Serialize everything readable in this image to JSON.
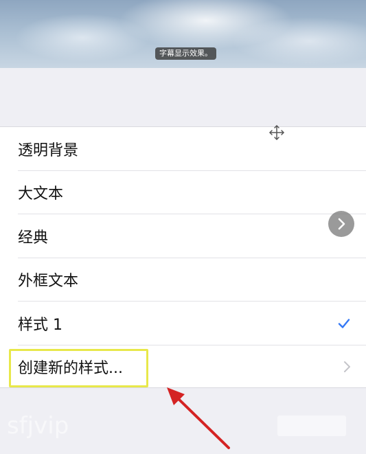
{
  "preview": {
    "subtitle_sample": "字幕显示效果。"
  },
  "styles_list": {
    "items": [
      {
        "label": "透明背景",
        "selected": false
      },
      {
        "label": "大文本",
        "selected": false
      },
      {
        "label": "经典",
        "selected": false
      },
      {
        "label": "外框文本",
        "selected": false
      },
      {
        "label": "样式 1",
        "selected": true
      }
    ],
    "create_new_label": "创建新的样式..."
  },
  "colors": {
    "checkmark": "#3478f6",
    "highlight_box": "#e8e84a",
    "annotation_arrow": "#d42323"
  },
  "watermark": "sfjvip"
}
